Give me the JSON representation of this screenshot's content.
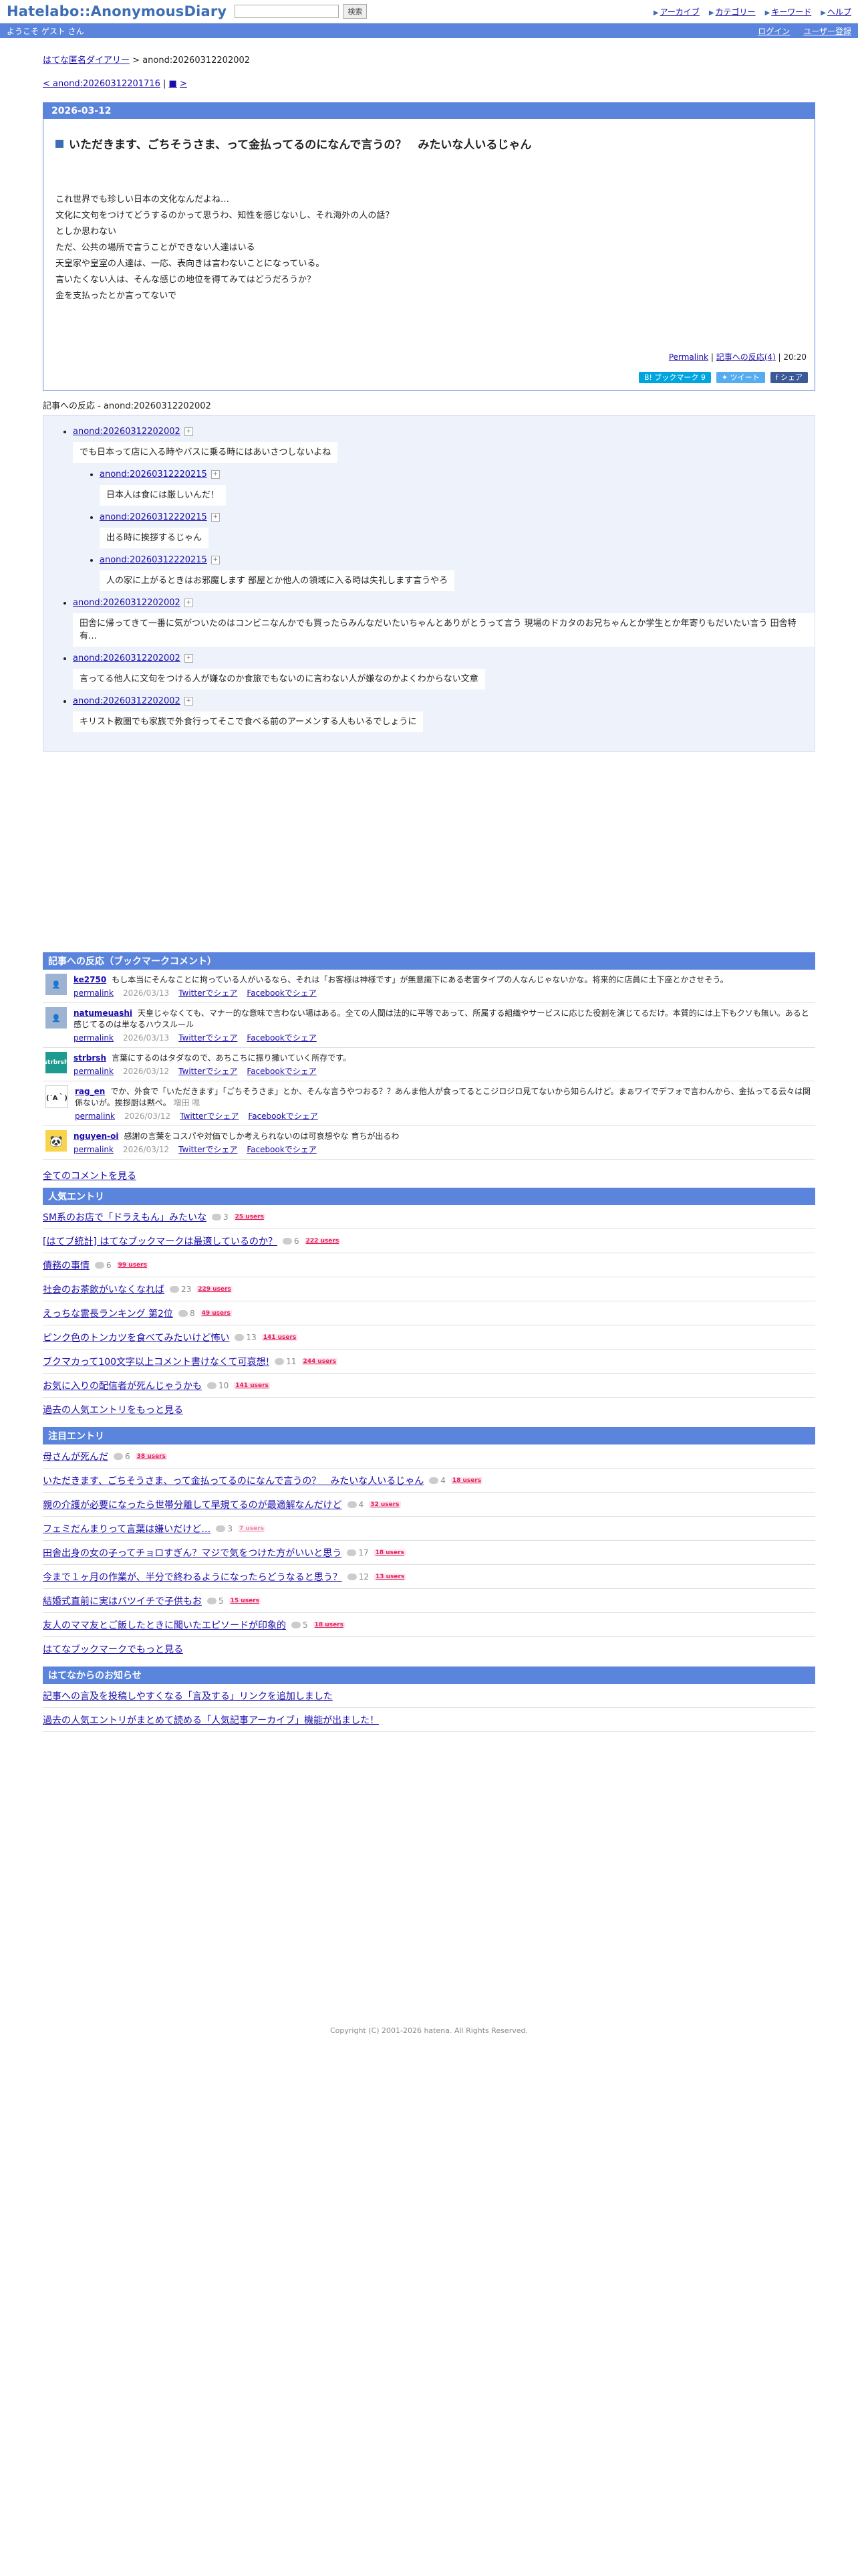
{
  "header": {
    "logo": "Hatelabo::AnonymousDiary",
    "search_value": "",
    "search_button": "検索",
    "nav": [
      "アーカイブ",
      "カテゴリー",
      "キーワード",
      "ヘルプ"
    ],
    "welcome": "ようこそ ゲスト さん",
    "login": "ログイン",
    "register": "ユーザー登録"
  },
  "breadcrumb": {
    "root": "はてな匿名ダイアリー",
    "sep": ">",
    "current": "anond:20260312202002"
  },
  "prevnext": {
    "prev": "< anond:20260312201716",
    "sep": "|",
    "up": "■",
    "next": ">"
  },
  "entry": {
    "date": "2026-03-12",
    "title": "いただきます、ごちそうさま、って金払ってるのになんで言うの？　みたいな人いるじゃん",
    "lines": [
      "これ世界でも珍しい日本の文化なんだよね…",
      "文化に文句をつけてどうするのかって思うわ、知性を感じないし、それ海外の人の話？",
      "としか思わない",
      "ただ、公共の場所で言うことができない人達はいる",
      "天皇家や皇室の人達は、一応、表向きは言わないことになっている。",
      "言いたくない人は、そんな感じの地位を得てみてはどうだろうか？",
      "金を支払ったとか言ってないで"
    ],
    "permalink": "Permalink",
    "sep": "|",
    "reactions_link": "記事への反応(4)",
    "time": "20:20",
    "share": {
      "hatena": "B! ブックマーク 9",
      "twitter": "ツイート",
      "facebook": "シェア"
    }
  },
  "refs": {
    "heading": "記事への反応 - anond:20260312202002",
    "items": [
      {
        "id": "anond:20260312202002",
        "text": "でも日本って店に入る時やバスに乗る時にはあいさつしないよね",
        "children": [
          {
            "id": "anond:20260312220215",
            "text": "日本人は食には厳しいんだ！"
          },
          {
            "id": "anond:20260312220215",
            "text": "出る時に挨拶するじゃん"
          },
          {
            "id": "anond:20260312220215",
            "text": "人の家に上がるときはお邪魔します 部屋とか他人の領域に入る時は失礼します言うやろ"
          }
        ]
      },
      {
        "id": "anond:20260312202002",
        "text": "田舎に帰ってきて一番に気がついたのはコンビニなんかでも買ったらみんなだいたいちゃんとありがとうって言う 現場のドカタのお兄ちゃんとか学生とか年寄りもだいたい言う 田舎特有…",
        "children": []
      },
      {
        "id": "anond:20260312202002",
        "text": "言ってる他人に文句をつける人が嫌なのか食旅でもないのに言わない人が嫌なのかよくわからない文章",
        "children": []
      },
      {
        "id": "anond:20260312202002",
        "text": "キリスト教圏でも家族で外食行ってそこで食べる前のアーメンする人もいるでしょうに",
        "children": []
      }
    ]
  },
  "bookmarks": {
    "heading": "記事への反応（ブックマークコメント）",
    "items": [
      {
        "user": "ke2750",
        "avatar": "",
        "comment": "もし本当にそんなことに拘っている人がいるなら、それは「お客様は神様です」が無意識下にある老害タイプの人なんじゃないかな。将来的に店員に土下座とかさせそう。",
        "date": "2026/03/13"
      },
      {
        "user": "natumeuashi",
        "avatar": "",
        "comment": "天皇じゃなくても、マナー的な意味で言わない場はある。全ての人間は法的に平等であって、所属する組織やサービスに応じた役割を演じてるだけ。本質的には上下もクソも無い。あると感じてるのは単なるハウスルール",
        "date": "2026/03/13"
      },
      {
        "user": "strbrsh",
        "avatar": "strbrsh",
        "comment": "言葉にするのはタダなので、あちこちに振り撒いていく所存です。",
        "date": "2026/03/12"
      },
      {
        "user": "rag_en",
        "avatar": "(´A｀)",
        "comment": "でか、外食で「いただきます」「ごちそうさま」とか、そんな言うやつおる？？あんま他人が食ってるとこジロジロ見てないから知らんけど。まぁワイでデフォで言わんから、金払ってる云々は関係ないが。挨拶厨は黙ぺ。",
        "extra": "増田 嗯",
        "date": "2026/03/12"
      },
      {
        "user": "nguyen-oi",
        "avatar": "🐼",
        "comment": "感謝の言葉をコスパや対価でしか考えられないのは可哀想やな 育ちが出るわ",
        "date": "2026/03/12"
      }
    ],
    "permalink": "permalink",
    "twitter": "Twitterでシェア",
    "facebook": "Facebookでシェア",
    "all_comments": "全てのコメントを見る"
  },
  "popular": {
    "heading": "人気エントリ",
    "items": [
      {
        "title": "SM系のお店で「ドラえもん」みたいな",
        "comments": "3",
        "users": "25 users"
      },
      {
        "title": "[はてブ統計] はてなブックマークは最適しているのか？",
        "comments": "6",
        "users": "222 users"
      },
      {
        "title": "債務の事情",
        "comments": "6",
        "users": "99 users"
      },
      {
        "title": "社会のお茶飲がいなくなれば",
        "comments": "23",
        "users": "229 users"
      },
      {
        "title": "えっちな霊長ランキング 第2位",
        "comments": "8",
        "users": "49 users"
      },
      {
        "title": "ピンク色のトンカツを食べてみたいけど怖い",
        "comments": "13",
        "users": "141 users"
      },
      {
        "title": "ブクマカって100文字以上コメント書けなくて可哀想!",
        "comments": "11",
        "users": "244 users"
      },
      {
        "title": "お気に入りの配信者が死んじゃうかも",
        "comments": "10",
        "users": "141 users"
      }
    ],
    "more": "過去の人気エントリをもっと見る"
  },
  "attention": {
    "heading": "注目エントリ",
    "items": [
      {
        "title": "母さんが死んだ",
        "comments": "6",
        "users": "38 users",
        "light": false
      },
      {
        "title": "いただきます、ごちそうさま、って金払ってるのになんで言うの？　みたいな人いるじゃん",
        "comments": "4",
        "users": "18 users",
        "light": false
      },
      {
        "title": "親の介護が必要になったら世帯分離して早規てるのが最適解なんだけど",
        "comments": "4",
        "users": "32 users",
        "light": false
      },
      {
        "title": "フェミだんまりって言葉は嫌いだけど…",
        "comments": "3",
        "users": "7 users",
        "light": true
      },
      {
        "title": "田舎出身の女の子ってチョロすぎん？マジで気をつけた方がいいと思う",
        "comments": "17",
        "users": "18 users",
        "light": false
      },
      {
        "title": "今まで１ヶ月の作業が、半分で終わるようになったらどうなると思う？",
        "comments": "12",
        "users": "13 users",
        "light": false
      },
      {
        "title": "結婚式直前に実はバツイチで子供もお",
        "comments": "5",
        "users": "15 users",
        "light": false
      },
      {
        "title": "友人のママ友とご飯したときに聞いたエピソードが印象的",
        "comments": "5",
        "users": "18 users",
        "light": false
      }
    ],
    "more": "はてなブックマークでもっと見る"
  },
  "notices": {
    "heading": "はてなからのお知らせ",
    "items": [
      "記事への言及を投稿しやすくなる「言及する」リンクを追加しました",
      "過去の人気エントリがまとめて読める「人気記事アーカイブ」機能が出ました！"
    ]
  },
  "footer": "Copyright (C) 2001-2026 hatena. All Rights Reserved."
}
